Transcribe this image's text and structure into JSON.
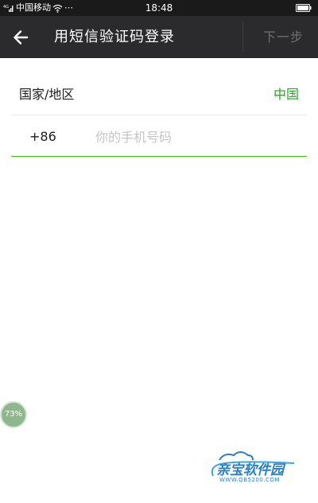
{
  "status_bar": {
    "carrier": "中国移动",
    "more": "⋯",
    "time": "18:48"
  },
  "title_bar": {
    "title": "用短信验证码登录",
    "next_label": "下一步"
  },
  "region": {
    "label": "国家/地区",
    "value": "中国"
  },
  "phone": {
    "country_code": "+86",
    "placeholder": "你的手机号码",
    "value": ""
  },
  "progress_badge": {
    "label": "73%",
    "percent": 73
  },
  "watermark": {
    "brand": "亲宝软件园",
    "url": "WWW.QB5200.COM"
  },
  "colors": {
    "title_bar": "#2b2b2d",
    "accent_green": "#1aad19",
    "input_underline": "#45c01a",
    "placeholder": "#c4c4c4"
  }
}
